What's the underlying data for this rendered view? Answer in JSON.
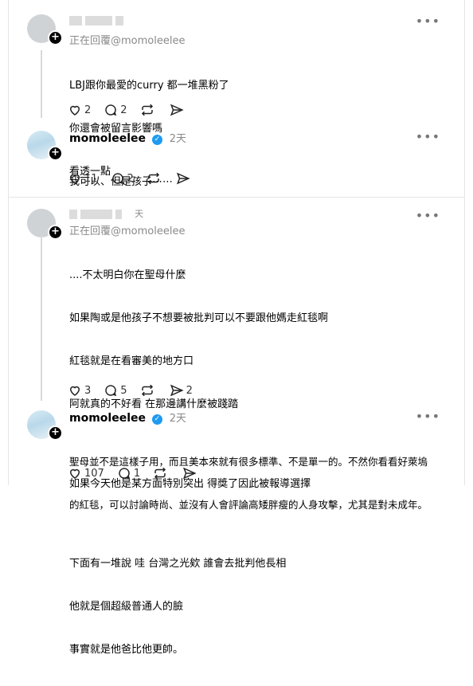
{
  "posts": [
    {
      "reply_to": "正在回覆@momoleelee",
      "lines": [
        "LBJ跟你最愛的curry 都一堆黑粉了",
        "你還會被留言影響嗎",
        "看透一點"
      ],
      "likes": "2",
      "comments": "2",
      "reposts": "",
      "shares": ""
    },
    {
      "username": "momoleelee",
      "time": "2天",
      "lines": [
        "我可以、但是孩子⋯⋯"
      ],
      "likes": "11",
      "comments": "2",
      "reposts": "",
      "shares": ""
    },
    {
      "time_partial": "天",
      "reply_to": "正在回覆@momoleelee",
      "paragraphs": [
        [
          "....不太明白你在聖母什麼",
          "如果陶或是他孩子不想要被批判可以不要跟他媽走紅毯啊",
          "紅毯就是在看審美的地方口",
          "阿就真的不好看 在那邊講什麼被踐踏"
        ],
        [
          "如果今天他是某方面特別突出 得獎了因此被報導選擇"
        ],
        [
          "下面有一堆說 哇 台灣之光欸 誰會去批判他長相",
          "他就是個超級普通人的臉",
          "事實就是他爸比他更帥。"
        ]
      ],
      "likes": "3",
      "comments": "5",
      "reposts": "",
      "shares": "2"
    },
    {
      "username": "momoleelee",
      "time": "2天",
      "lines": [
        "聖母並不是這樣子用，而且美本來就有很多標準、不是單一的。不然你看看好萊塢",
        "的紅毯，可以討論時尚、並沒有人會評論高矮胖瘦的人身攻擊，尤其是對未成年。"
      ],
      "likes": "107",
      "comments": "1",
      "reposts": "",
      "shares": ""
    }
  ],
  "icons": {
    "like": "heart-icon",
    "comment": "comment-icon",
    "repost": "repost-icon",
    "share": "share-icon",
    "more": "more-icon",
    "verified": "verified-badge-icon"
  },
  "colors": {
    "verified": "#1d9bf0",
    "meta": "#8a8a8a"
  }
}
